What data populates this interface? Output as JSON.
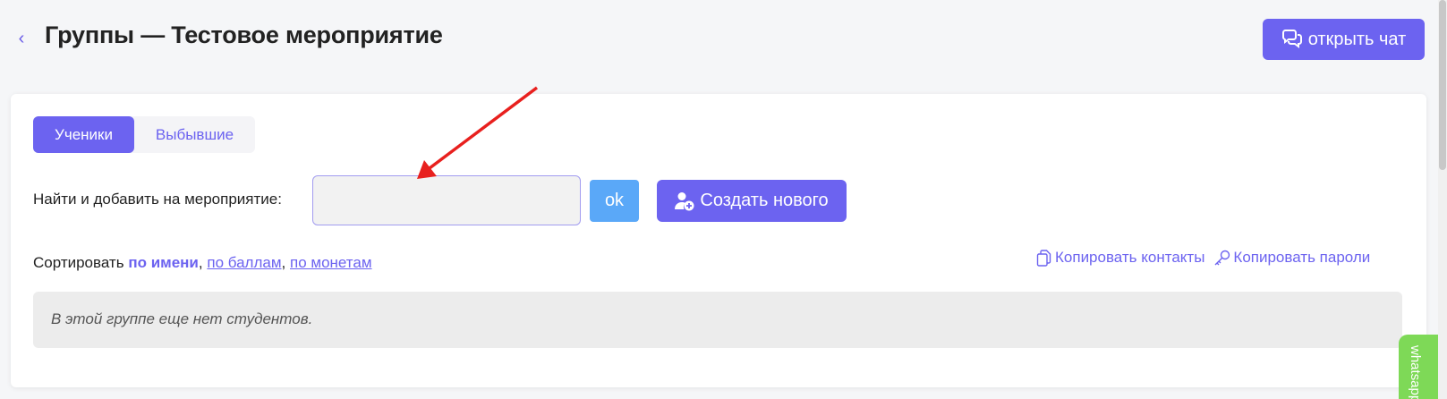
{
  "header": {
    "back_icon": "chevron-left-icon",
    "title": "Группы — Тестовое мероприятие",
    "chat_button_label": "открыть чат",
    "chat_icon": "chat-bubbles-icon"
  },
  "tabs": [
    {
      "label": "Ученики",
      "active": true
    },
    {
      "label": "Выбывшие",
      "active": false
    }
  ],
  "search": {
    "label": "Найти и добавить на мероприятие:",
    "value": "",
    "placeholder": "",
    "ok_label": "ok",
    "create_label": "Создать нового",
    "create_icon": "user-add-icon"
  },
  "sort": {
    "prefix": "Сортировать",
    "active": "по имени",
    "sep1": ",",
    "by_points": "по баллам",
    "sep2": ",",
    "by_coins": "по монетам"
  },
  "copy": {
    "contacts_label": "Копировать контакты",
    "contacts_icon": "copy-icon",
    "passwords_label": "Копировать пароли",
    "passwords_icon": "key-icon"
  },
  "empty_state": "В этой группе еще нет студентов.",
  "whatsapp_label": "whatsapp",
  "colors": {
    "accent": "#6c63f0",
    "ok_button": "#5aa8f8",
    "whatsapp": "#7ed957",
    "annotation_arrow": "#e8201e"
  }
}
